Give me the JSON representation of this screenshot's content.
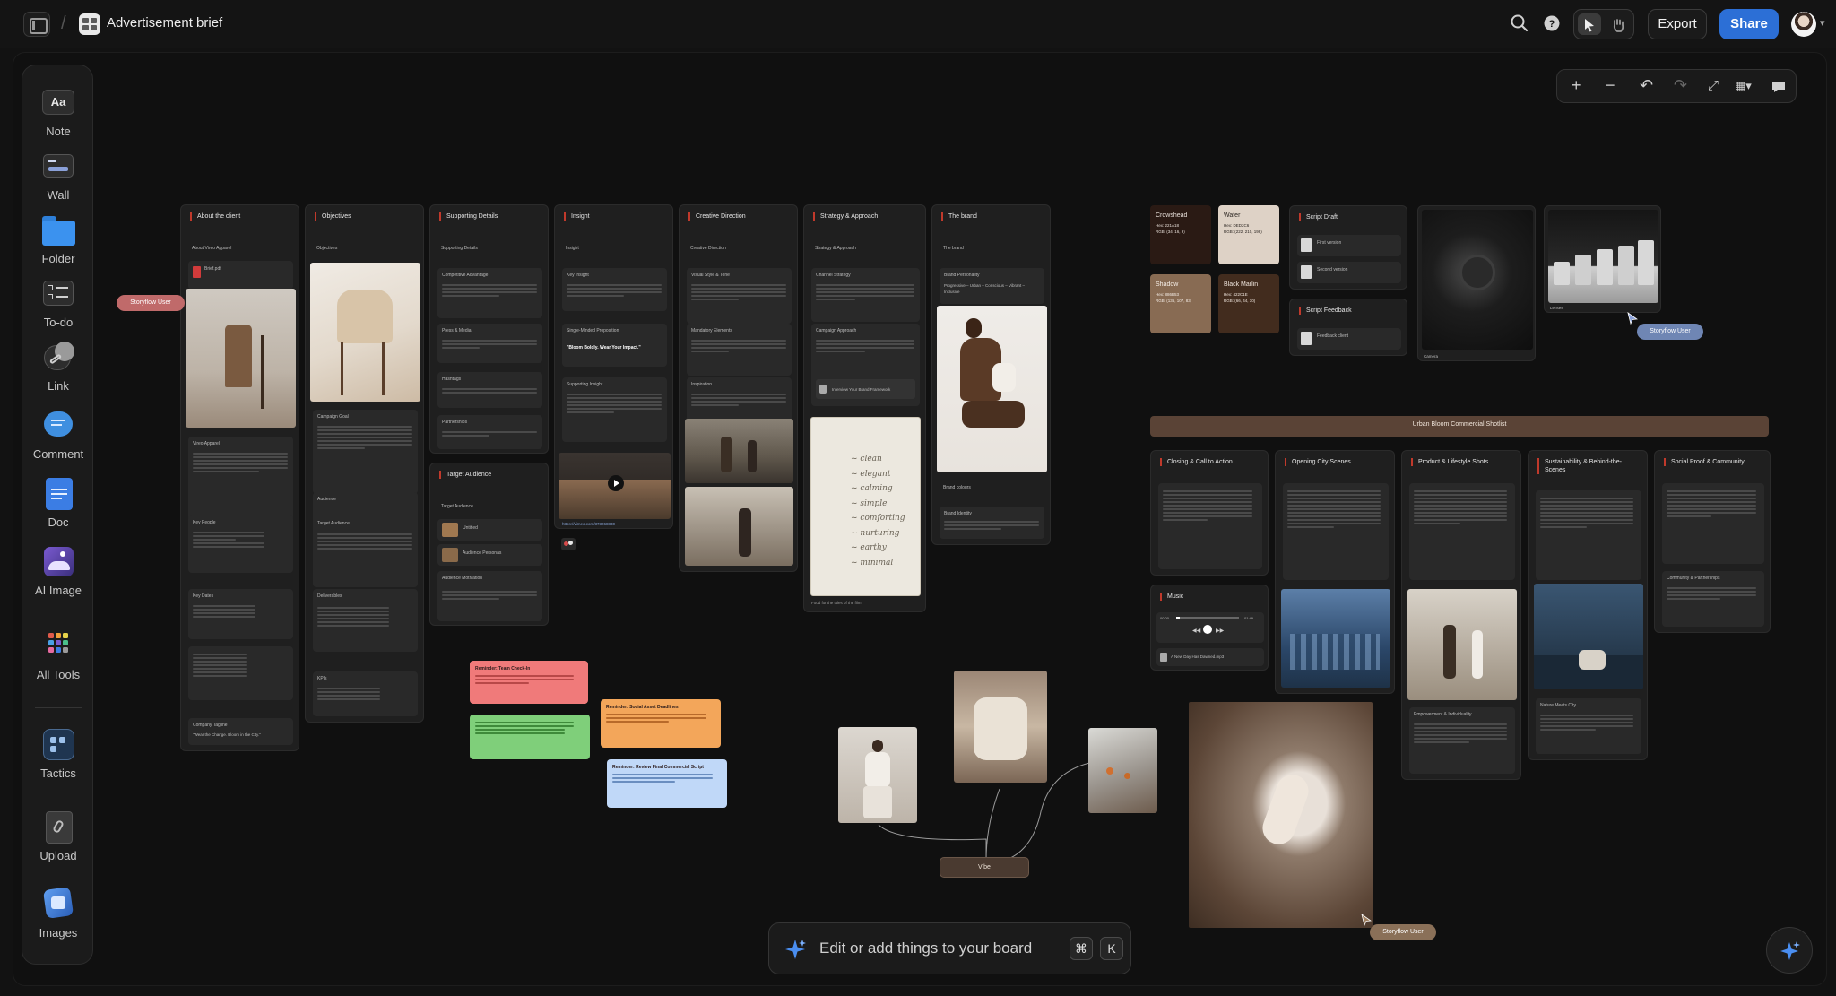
{
  "topbar": {
    "title": "Advertisement brief",
    "export_label": "Export",
    "share_label": "Share"
  },
  "tools": [
    {
      "label": "Note",
      "icon": "note-icon"
    },
    {
      "label": "Wall",
      "icon": "wall-icon"
    },
    {
      "label": "Folder",
      "icon": "folder-icon"
    },
    {
      "label": "To-do",
      "icon": "todo-icon"
    },
    {
      "label": "Link",
      "icon": "link-icon"
    },
    {
      "label": "Comment",
      "icon": "comment-icon"
    },
    {
      "label": "Doc",
      "icon": "doc-icon"
    },
    {
      "label": "AI Image",
      "icon": "ai-image-icon"
    },
    {
      "label": "All Tools",
      "icon": "all-tools-icon"
    },
    {
      "label": "Tactics",
      "icon": "tactics-icon"
    },
    {
      "label": "Upload",
      "icon": "upload-icon"
    },
    {
      "label": "Images",
      "icon": "images-icon"
    }
  ],
  "note_glyph": "Aa",
  "columns": {
    "about": {
      "title": "About the client",
      "sub": "About Vireo Apparel",
      "brief": "Brief.pdf",
      "section2": "Vireo Apparel",
      "key_people": "Key People",
      "key_dates": "Key Dates",
      "tagline_h": "Company Tagline",
      "tagline": "\"Wear the Change. Bloom in the City.\""
    },
    "objectives": {
      "title": "Objectives",
      "sub": "Objectives",
      "campaign_goal": "Campaign Goal",
      "audience": "Audience",
      "target_audience": "Target Audience",
      "deliverables": "Deliverables",
      "kpis": "KPIs"
    },
    "supporting": {
      "title": "Supporting Details",
      "sub": "Supporting Details",
      "comp": "Competitive Advantage",
      "press": "Press & Media",
      "hashtags": "Hashtags",
      "partnerships": "Partnerships"
    },
    "insight": {
      "title": "Insight",
      "sub": "Insight",
      "key": "Key Insight",
      "smp": "Single-Minded Proposition",
      "smp_text": "\"Bloom Boldly. Wear Your Impact.\"",
      "support": "Supporting Insight",
      "video_url": "https://vimeo.com/373268830"
    },
    "creative": {
      "title": "Creative Direction",
      "sub": "Creative Direction",
      "visual": "Visual Style & Tone",
      "mandatory": "Mandatory Elements",
      "inspiration": "Inspiration"
    },
    "strategy": {
      "title": "Strategy & Approach",
      "sub": "Strategy & Approach",
      "channel": "Channel Strategy",
      "campaign": "Campaign Approach",
      "interview": "Interview Your Brand Framework",
      "poem_caption": "Food for the titles of the film"
    },
    "brand": {
      "title": "The brand",
      "sub": "The brand",
      "personality": "Brand Personality",
      "personality_text": "Progressive – Urban – Conscious – Vibrant – Inclusive",
      "colours": "Brand colours",
      "identity": "Brand Identity"
    },
    "target": {
      "title": "Target Audience",
      "sub": "Target Audience",
      "item1": "Untitled",
      "item2": "Audience Personas",
      "motivation": "Audience Motivation"
    }
  },
  "poem_words": [
    "~ clean",
    "~ elegant",
    "~ calming",
    "~ simple",
    "~ comforting",
    "~ nurturing",
    "~ earthy",
    "~ minimal"
  ],
  "swatches": [
    {
      "name": "Crowshead",
      "hex": "Hex: 221A18",
      "rgb": "RGB: (34, 16, 9)",
      "color": "#2a1a14",
      "text": "#e8e0da"
    },
    {
      "name": "Wafer",
      "hex": "Hex: DED2C6",
      "rgb": "RGB: (222, 210, 198)",
      "color": "#ded2c6",
      "text": "#2a2420"
    },
    {
      "name": "Shadow",
      "hex": "Hex: 886B53",
      "rgb": "RGB: (136, 107, 83)",
      "color": "#886b53",
      "text": "#f5ede6"
    },
    {
      "name": "Black Marlin",
      "hex": "Hex: 422C1E",
      "rgb": "RGB: (66, 44, 30)",
      "color": "#422c1e",
      "text": "#f0e6de"
    }
  ],
  "script": {
    "draft": "Script Draft",
    "first": "First version",
    "second": "Second version",
    "feedback": "Script Feedback",
    "feedback_item": "Feedback client",
    "camera": "Camera",
    "lenses": "Lenses"
  },
  "shotlist": {
    "header": "Urban Bloom Commercial Shotlist",
    "columns": [
      "Closing & Call to Action",
      "Opening City Scenes",
      "Product & Lifestyle Shots",
      "Sustainability & Behind-the-Scenes",
      "Social Proof & Community"
    ],
    "music": "Music",
    "track": "A New Day Has Dawned.mp3",
    "time_start": "00:00",
    "time_end": "01:49",
    "empowerment": "Empowerment & Individuality",
    "nature": "Nature Meets City",
    "community": "Community & Partnerships"
  },
  "tags": {
    "user1": "Storyflow User",
    "user2": "Storyflow User",
    "user3": "Storyflow User"
  },
  "vibe": "Vibe",
  "stickies": {
    "red": "Reminder: Team Check-In",
    "orange": "Reminder: Social Asset Deadlines",
    "blue": "Reminder: Review Final Commercial Script"
  },
  "bottom": {
    "placeholder": "Edit or add things to your board",
    "cmd": "⌘",
    "key": "K"
  }
}
